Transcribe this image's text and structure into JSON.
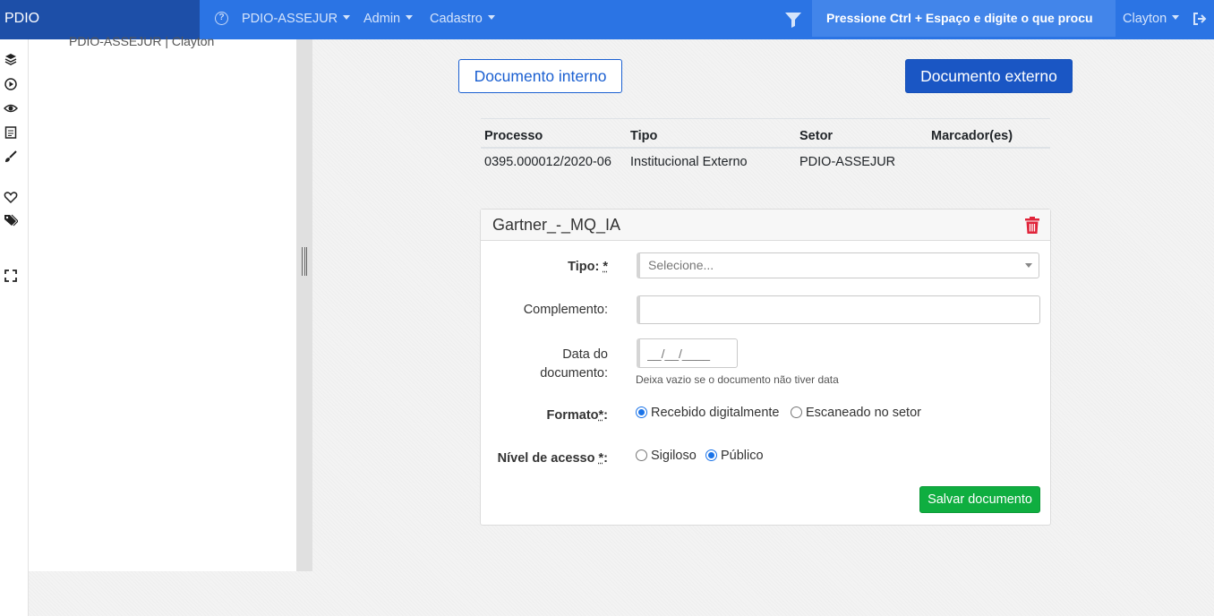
{
  "navbar": {
    "brand": "PDIO",
    "unit_menu": "PDIO-ASSEJUR",
    "admin_menu": "Admin",
    "cadastro_menu": "Cadastro",
    "search_placeholder": "Pressione Ctrl + Espaço e digite o que procu",
    "user_menu": "Clayton"
  },
  "sidepanel": {
    "title": "PDIO-ASSEJUR | Clayton"
  },
  "actions": {
    "internal_doc": "Documento interno",
    "external_doc": "Documento externo"
  },
  "process_table": {
    "headers": [
      "Processo",
      "Tipo",
      "Setor",
      "Marcador(es)"
    ],
    "row": [
      "0395.000012/2020-06",
      "Institucional Externo",
      "PDIO-ASSEJUR",
      ""
    ]
  },
  "document_card": {
    "title": "Gartner_-_MQ_IA",
    "tipo_label": "Tipo:",
    "tipo_required": "*",
    "tipo_placeholder": "Selecione...",
    "complemento_label": "Complemento:",
    "complemento_value": "",
    "data_label_line1": "Data do",
    "data_label_line2": "documento:",
    "data_placeholder": "__/__/____",
    "data_help": "Deixa vazio se o documento não tiver data",
    "formato_label": "Formato",
    "formato_required": "*",
    "formato_colon": ":",
    "formato_options": [
      "Recebido digitalmente",
      "Escaneado no setor"
    ],
    "formato_selected": "Recebido digitalmente",
    "nivel_label": "Nível de acesso",
    "nivel_required": "*",
    "nivel_colon": ":",
    "nivel_options": [
      "Sigiloso",
      "Público"
    ],
    "nivel_selected": "Público",
    "save_button": "Salvar documento"
  },
  "icons": {
    "help": "help-circle-icon",
    "filter": "filter-icon",
    "logout": "logout-icon",
    "trash": "trash-icon",
    "rail": [
      "layers-icon",
      "play-circle-icon",
      "eye-icon",
      "notepad-icon",
      "brush-icon",
      "heart-icon",
      "tags-icon",
      "expand-icon"
    ]
  },
  "colors": {
    "navbar": "#2b74e4",
    "brand": "#1d4fa8",
    "primary": "#1a56c4",
    "success": "#0fae40",
    "danger": "#e0243a"
  }
}
